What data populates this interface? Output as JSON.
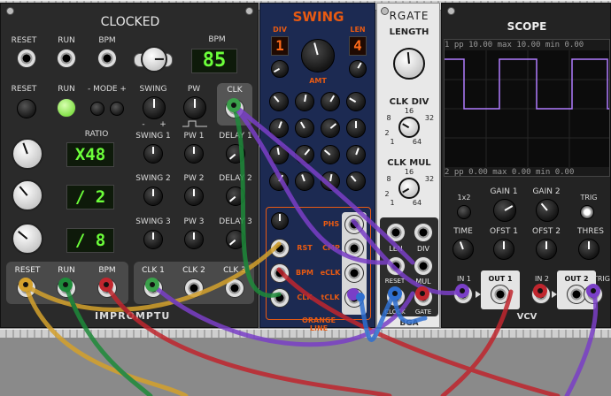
{
  "modules": {
    "clocked": {
      "title": "CLOCKED",
      "brand": "IMPROMPTU",
      "top_labels": [
        "RESET",
        "RUN",
        "BPM"
      ],
      "bpm_label": "BPM",
      "bpm_display": "85",
      "row2_labels": {
        "reset": "RESET",
        "run": "RUN",
        "mode": "- MODE +",
        "swing": "SWING",
        "pw": "PW",
        "clk": "CLK"
      },
      "swing_marks": {
        "minus": "-",
        "plus": "+"
      },
      "ratio_label": "RATIO",
      "ratio_displays": [
        "X48",
        "/ 2",
        "/ 8"
      ],
      "swing_labels": [
        "SWING 1",
        "SWING 2",
        "SWING 3"
      ],
      "pw_labels": [
        "PW 1",
        "PW 2",
        "PW 3"
      ],
      "delay_labels": [
        "DELAY 1",
        "DELAY 2",
        "DELAY 3"
      ],
      "bottom_left_labels": [
        "RESET",
        "RUN",
        "BPM"
      ],
      "bottom_right_labels": [
        "CLK 1",
        "CLK 2",
        "CLK 3"
      ]
    },
    "swing": {
      "title": "SWING",
      "div_label": "DIV",
      "len_label": "LEN",
      "div_value": "1",
      "len_value": "4",
      "amt_label": "AMT",
      "jack_labels": {
        "rst": "RST",
        "bpm": "BPM",
        "clk": "CLK",
        "phs": "PHS",
        "cmp": "CMP",
        "eclk": "eCLK",
        "tclk": "tCLK"
      },
      "footer": "ORANGE LINE"
    },
    "rgate": {
      "title": "RGATE",
      "length_label": "LENGTH",
      "clkdiv_label": "CLK DIV",
      "clkmul_label": "CLK MUL",
      "scale_marks": {
        "top": "16",
        "left": "8",
        "right": "32",
        "lower_left": "2",
        "bottom_left": "1",
        "bottom_right": "64"
      },
      "jack_labels": [
        "LEN",
        "DIV",
        "RESET",
        "MUL",
        "CLOCK",
        "GATE"
      ],
      "brand": "BGA"
    },
    "scope": {
      "title": "SCOPE",
      "channel1": {
        "index": "1",
        "pp_label": "pp",
        "pp": "10.00",
        "max_label": "max",
        "max": "10.00",
        "min_label": "min",
        "min": "0.00"
      },
      "channel2": {
        "index": "2",
        "pp_label": "pp",
        "pp": "0.00",
        "max_label": "max",
        "max": "0.00",
        "min_label": "min",
        "min": "0.00"
      },
      "labels": {
        "x12": "1x2",
        "gain1": "GAIN 1",
        "gain2": "GAIN 2",
        "trig": "TRIG",
        "time": "TIME",
        "ofst1": "OFST 1",
        "ofst2": "OFST 2",
        "thres": "THRES",
        "in1": "IN 1",
        "out1": "OUT 1",
        "in2": "IN 2",
        "out2": "OUT 2",
        "trig_jack": "TRIG"
      },
      "brand": "VCV"
    }
  },
  "colors": {
    "cable_yellow": "#d4a12c",
    "cable_green": "#1e8a3a",
    "cable_red": "#c0262e",
    "cable_purple": "#7a3fc7",
    "cable_blue": "#2f6fd0",
    "swing_accent": "#e85a12",
    "seg_green": "#6cff3a",
    "scope_trace": "#b07cff"
  }
}
